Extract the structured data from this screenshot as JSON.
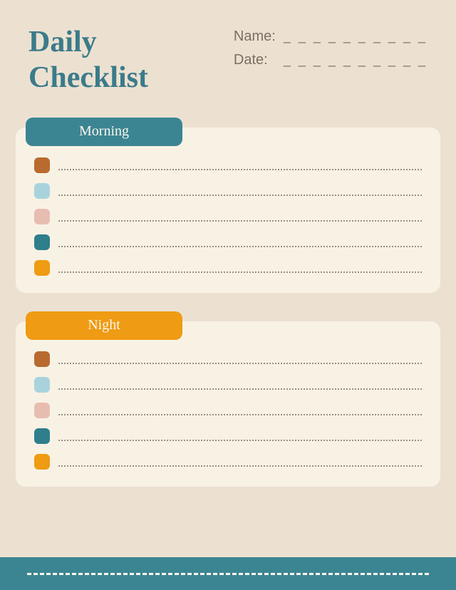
{
  "title_line1": "Daily",
  "title_line2": "Checklist",
  "meta": {
    "name_label": "Name:",
    "date_label": "Date:",
    "blank_line": "_ _ _ _ _ _ _ _ _ _"
  },
  "sections": {
    "morning": {
      "label": "Morning",
      "tab_color": "#3b8593",
      "items": [
        {
          "color": "#b96a2f"
        },
        {
          "color": "#a9d3dc"
        },
        {
          "color": "#e8bdb1"
        },
        {
          "color": "#2f7e8c"
        },
        {
          "color": "#ef9b13"
        }
      ]
    },
    "night": {
      "label": "Night",
      "tab_color": "#ef9b13",
      "items": [
        {
          "color": "#b96a2f"
        },
        {
          "color": "#a9d3dc"
        },
        {
          "color": "#e8bdb1"
        },
        {
          "color": "#2f7e8c"
        },
        {
          "color": "#ef9b13"
        }
      ]
    }
  },
  "colors": {
    "background": "#ece1d1",
    "panel": "#f8f2e5",
    "teal": "#3b8593",
    "orange": "#ef9b13",
    "text_muted": "#7a6f62"
  }
}
